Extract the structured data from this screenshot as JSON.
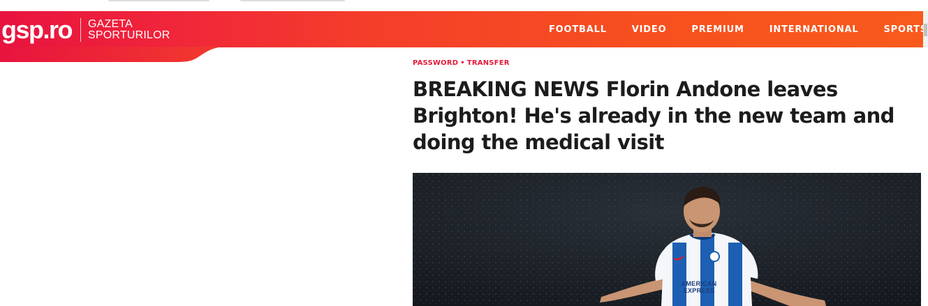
{
  "brand": {
    "logo": "gsp.ro",
    "name_line1": "GAZETA",
    "name_line2": "SPORTURILOR",
    "colors": {
      "header_start": "#e8133f",
      "header_end": "#f85a1c",
      "accent": "#e41b3a"
    }
  },
  "nav": {
    "items": [
      {
        "label": "FOOTBALL"
      },
      {
        "label": "VIDEO"
      },
      {
        "label": "PREMIUM"
      },
      {
        "label": "INTERNATIONAL"
      },
      {
        "label": "SPORTS"
      },
      {
        "label": "S"
      }
    ]
  },
  "article": {
    "breadcrumb": {
      "first": "PASSWORD",
      "separator": "•",
      "second": "TRANSFER"
    },
    "headline": "BREAKING NEWS Florin Andone leaves Brighton! He's already in the new team and doing the medical visit",
    "image": {
      "jersey_sponsor_line1": "AMERICAN",
      "jersey_sponsor_line2": "EXPRESS"
    }
  }
}
